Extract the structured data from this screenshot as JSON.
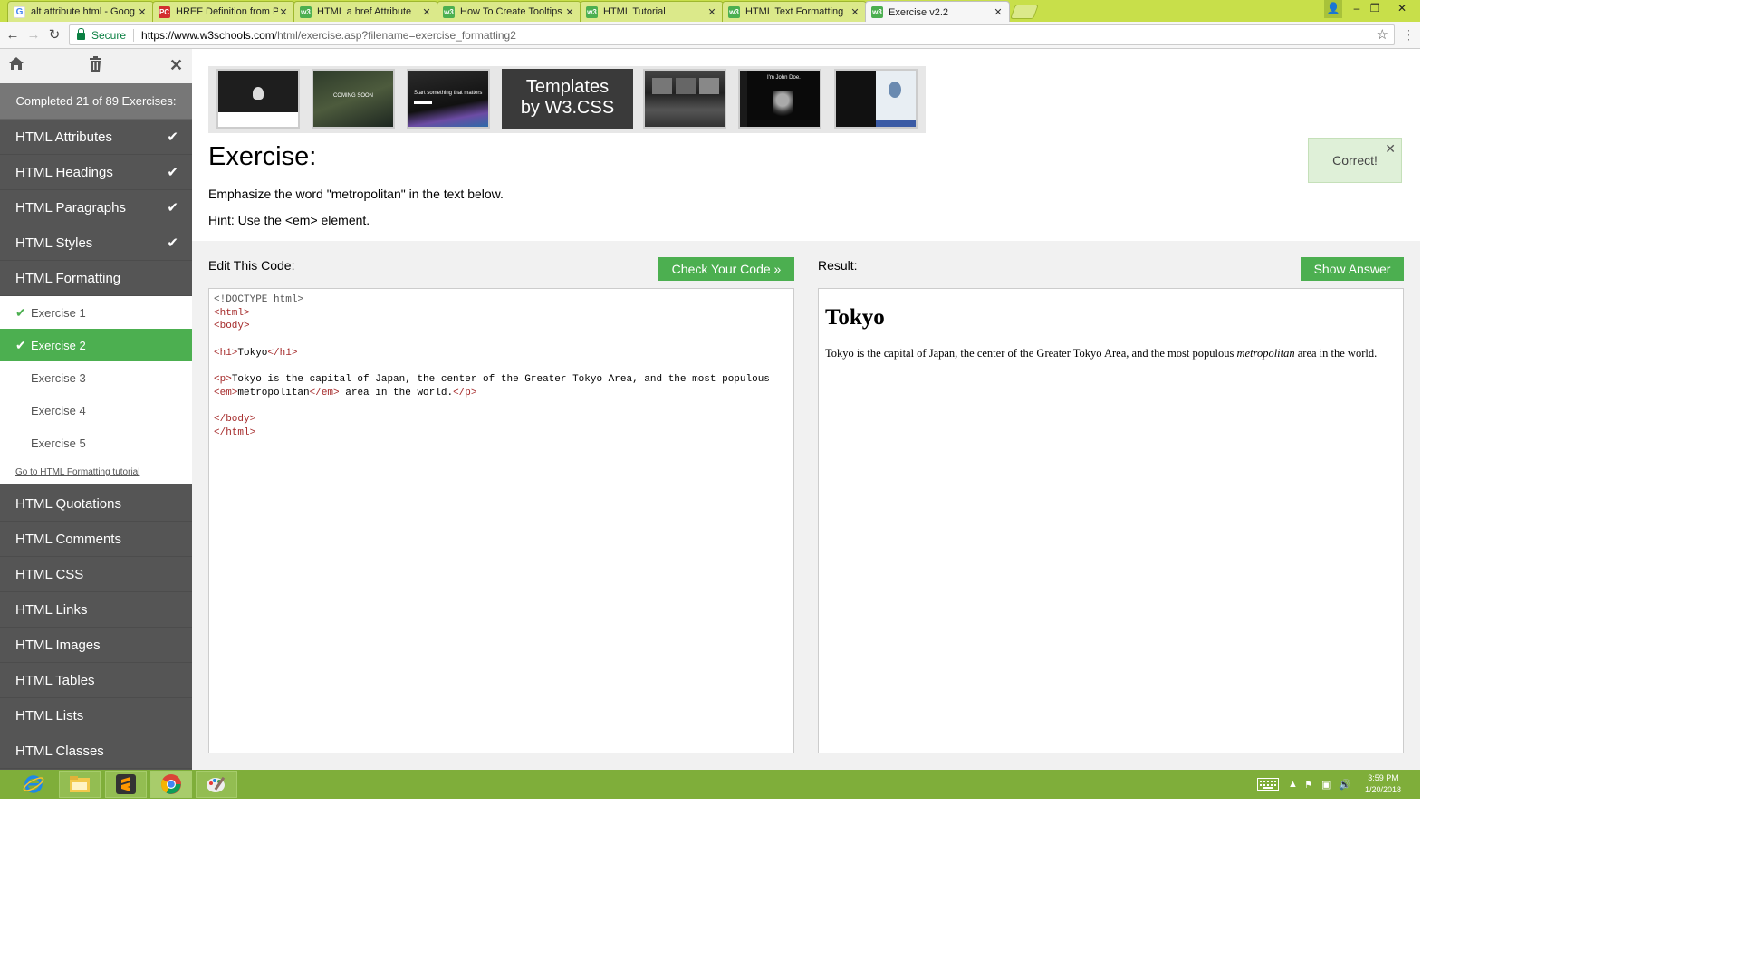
{
  "browser": {
    "tabs": [
      {
        "title": "alt attribute html - Goog",
        "favicon": "G",
        "kind": "google"
      },
      {
        "title": "HREF Definition from PC",
        "favicon": "PC",
        "kind": "pc"
      },
      {
        "title": "HTML a href Attribute",
        "favicon": "w3",
        "kind": "w3"
      },
      {
        "title": "How To Create Tooltips",
        "favicon": "w3",
        "kind": "w3"
      },
      {
        "title": "HTML Tutorial",
        "favicon": "w3",
        "kind": "w3"
      },
      {
        "title": "HTML Text Formatting",
        "favicon": "w3",
        "kind": "w3"
      },
      {
        "title": "Exercise v2.2",
        "favicon": "w3",
        "kind": "w3",
        "active": true
      }
    ],
    "tab_close_glyph": "✕",
    "security_label": "Secure",
    "url_host": "https://www.w3schools.com",
    "url_path": "/html/exercise.asp?filename=exercise_formatting2",
    "window_controls": {
      "profile": "👤",
      "minimize": "–",
      "maximize": "❐",
      "close": "✕"
    }
  },
  "sidebar": {
    "icons": {
      "home": "home-icon",
      "trash": "trash-icon",
      "close": "close-icon"
    },
    "completed_text": "Completed 21 of 89 Exercises:",
    "topics_before": [
      {
        "label": "HTML Attributes",
        "done": true
      },
      {
        "label": "HTML Headings",
        "done": true
      },
      {
        "label": "HTML Paragraphs",
        "done": true
      },
      {
        "label": "HTML Styles",
        "done": true
      }
    ],
    "current_topic": "HTML Formatting",
    "exercises": [
      {
        "label": "Exercise 1",
        "done": true
      },
      {
        "label": "Exercise 2",
        "done": true,
        "active": true
      },
      {
        "label": "Exercise 3",
        "done": false
      },
      {
        "label": "Exercise 4",
        "done": false
      },
      {
        "label": "Exercise 5",
        "done": false
      }
    ],
    "tutorial_link": "Go to HTML Formatting tutorial",
    "topics_after": [
      {
        "label": "HTML Quotations"
      },
      {
        "label": "HTML Comments"
      },
      {
        "label": "HTML CSS"
      },
      {
        "label": "HTML Links"
      },
      {
        "label": "HTML Images"
      },
      {
        "label": "HTML Tables"
      },
      {
        "label": "HTML Lists"
      },
      {
        "label": "HTML Classes"
      }
    ]
  },
  "templates": {
    "ad_line1": "Templates",
    "ad_line2": "by W3.CSS",
    "thumb_texts": [
      "",
      "COMING SOON",
      "Start something that matters",
      "",
      "I'm John Doe."
    ]
  },
  "exercise": {
    "title": "Exercise:",
    "description": "Emphasize the word \"metropolitan\" in the text below.",
    "hint": "Hint: Use the <em> element.",
    "correct_text": "Correct!",
    "edit_label": "Edit This Code:",
    "check_button": "Check Your Code »",
    "result_label": "Result:",
    "answer_button": "Show Answer",
    "code_lines": [
      "<!DOCTYPE html>",
      "<html>",
      "<body>",
      "",
      "<h1>Tokyo</h1>",
      "",
      "<p>Tokyo is the capital of Japan, the center of the Greater Tokyo Area, and the most populous",
      "<em>metropolitan</em> area in the world.</p>",
      "",
      "</body>",
      "</html>"
    ],
    "result_heading": "Tokyo",
    "result_text_before": "Tokyo is the capital of Japan, the center of the Greater Tokyo Area, and the most populous ",
    "result_text_em": "metropolitan",
    "result_text_after": " area in the world."
  },
  "taskbar": {
    "apps": [
      "internet-explorer-icon",
      "file-explorer-icon",
      "sublime-text-icon",
      "chrome-icon",
      "paint-icon"
    ],
    "time": "3:59 PM",
    "date": "1/20/2018"
  },
  "colors": {
    "accent_green": "#4caf50",
    "sidebar_bg": "#555555",
    "tabbar_bg": "#c8df4a",
    "taskbar_bg": "#7fae3a"
  }
}
